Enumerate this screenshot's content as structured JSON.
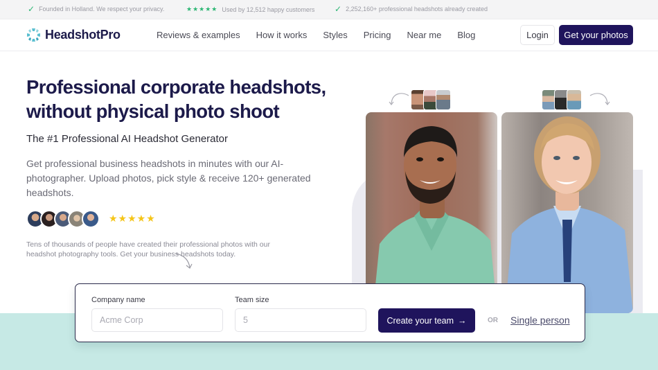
{
  "topbar": {
    "privacy_text": "Founded in Holland. We respect your privacy.",
    "customers_text": "Used by 12,512 happy customers",
    "created_text": "2,252,160+ professional headshots already created",
    "stars": "★★★★★",
    "check_glyph": "✓",
    "accent_color": "#2bb673"
  },
  "nav": {
    "brand": "HeadshotPro",
    "links": [
      "Reviews & examples",
      "How it works",
      "Styles",
      "Pricing",
      "Near me",
      "Blog"
    ],
    "login_label": "Login",
    "cta_label": "Get your photos",
    "brand_color": "#1f145c"
  },
  "hero": {
    "title": "Professional corporate headshots, without physical photo shoot",
    "subtitle": "The #1 Professional AI Headshot Generator",
    "description": "Get professional business headshots in minutes with our AI-photographer. Upload photos, pick style & receive 120+ generated headshots.",
    "rating_stars": "★★★★★",
    "social_proof": "Tens of thousands of people have created their professional photos with our headshot photography tools. Get your business headshots today."
  },
  "examples": {
    "left_photo": "man-headshot-green-shirt",
    "right_photo": "woman-headshot-blue-suit"
  },
  "form": {
    "company_label": "Company name",
    "company_placeholder": "Acme Corp",
    "company_value": "",
    "team_label": "Team size",
    "team_placeholder": "5",
    "team_value": "",
    "create_label": "Create your team",
    "create_arrow": "→",
    "or_label": "OR",
    "single_label": "Single person"
  }
}
